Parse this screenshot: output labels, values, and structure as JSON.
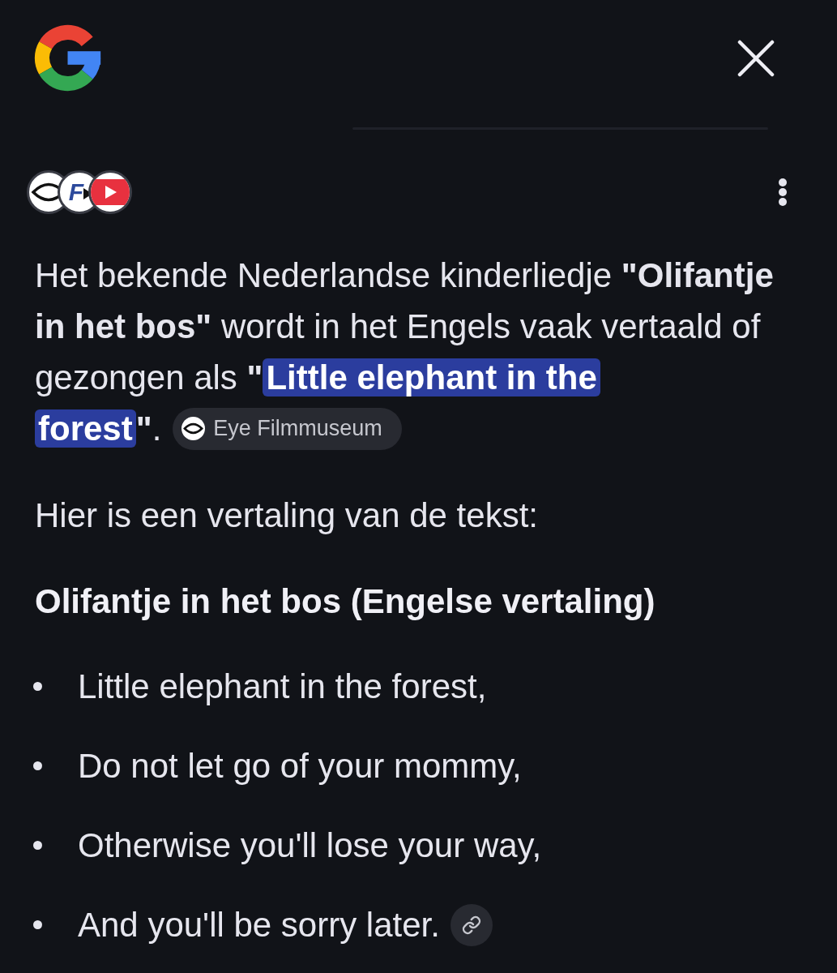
{
  "sources": [
    {
      "kind": "eye"
    },
    {
      "kind": "letter",
      "letter": "F"
    },
    {
      "kind": "play"
    }
  ],
  "intro": {
    "text": "Het bekende Nederlandse kinderliedje **\"Olifantje in het bos\"** wordt in het Engels vaak vertaald of gezongen als **\"**",
    "highlight": {
      "text": "Little elephant in the forest",
      "highlighted": true
    },
    "after": "**\"**.",
    "source_chip": {
      "label": "Eye Filmmuseum"
    }
  },
  "lead": "Hier is een vertaling van de tekst:",
  "heading": "Olifantje in het bos (Engelse vertaling)",
  "verses": [
    {
      "text": "Little elephant in the forest,",
      "has_link": false
    },
    {
      "text": "Do not let go of your mommy,",
      "has_link": false
    },
    {
      "text": "Otherwise you'll lose your way,",
      "has_link": false
    },
    {
      "text": "And you'll be sorry later.",
      "has_link": true
    }
  ]
}
